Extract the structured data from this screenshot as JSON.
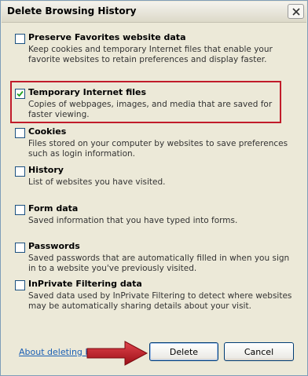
{
  "window": {
    "title": "Delete Browsing History"
  },
  "options": [
    {
      "label": "Preserve Favorites website data",
      "checked": false,
      "description": "Keep cookies and temporary Internet files that enable your favorite websites to retain preferences and display faster."
    },
    {
      "label": "Temporary Internet files",
      "checked": true,
      "description": "Copies of webpages, images, and media that are saved for faster viewing."
    },
    {
      "label": "Cookies",
      "checked": false,
      "description": "Files stored on your computer by websites to save preferences such as login information."
    },
    {
      "label": "History",
      "checked": false,
      "description": "List of websites you have visited."
    },
    {
      "label": "Form data",
      "checked": false,
      "description": "Saved information that you have typed into forms."
    },
    {
      "label": "Passwords",
      "checked": false,
      "description": "Saved passwords that are automatically filled in when you sign in to a website you've previously visited."
    },
    {
      "label": "InPrivate Filtering data",
      "checked": false,
      "description": "Saved data used by InPrivate Filtering to detect where websites may be automatically sharing details about your visit."
    }
  ],
  "footer": {
    "about_link": "About deleting bro",
    "delete_label": "Delete",
    "cancel_label": "Cancel"
  },
  "colors": {
    "highlight": "#c11b2a",
    "arrow": "#b5121b",
    "link": "#1a5fb4"
  }
}
